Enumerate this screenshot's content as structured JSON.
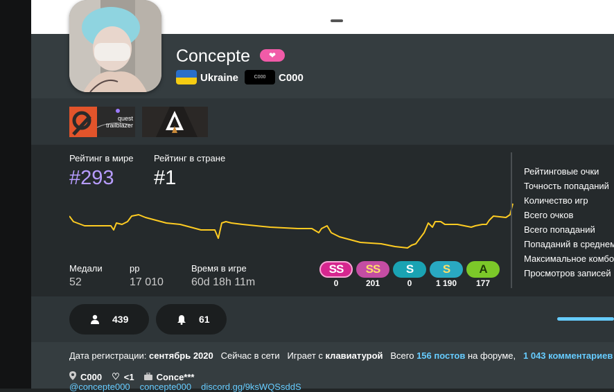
{
  "profile": {
    "username": "Concepte",
    "country": "Ukraine",
    "team_tag": "C000",
    "team_name": "C000"
  },
  "badges": {
    "badge1_text": "quest trailblazer"
  },
  "ranks": {
    "global_label": "Рейтинг в мире",
    "global_value": "#293",
    "country_label": "Рейтинг в стране",
    "country_value": "#1"
  },
  "summary": {
    "medals_label": "Медали",
    "medals_value": "52",
    "pp_label": "pp",
    "pp_value": "17 010",
    "playtime_label": "Время в игре",
    "playtime_value": "60d 18h 11m"
  },
  "grades": [
    {
      "label": "SS",
      "count": "0",
      "color": "#d6268f"
    },
    {
      "label": "SS",
      "count": "201",
      "color": "#c44da3"
    },
    {
      "label": "S",
      "count": "0",
      "color": "#1aa3b3"
    },
    {
      "label": "S",
      "count": "1 190",
      "color": "#29a9c2"
    },
    {
      "label": "A",
      "count": "177",
      "color": "#7cc829"
    }
  ],
  "stat_labels": [
    "Рейтинговые очки",
    "Точность попаданий",
    "Количество игр",
    "Всего очков",
    "Всего попаданий",
    "Попаданий в среднем",
    "Максимальное комбо",
    "Просмотров записей"
  ],
  "actions": {
    "friends_count": "439",
    "followers_count": "61"
  },
  "info": {
    "joined_prefix": "Дата регистрации:",
    "joined_value": "сентябрь 2020",
    "online_text": "Сейчас в сети",
    "plays_with_prefix": "Играет с",
    "plays_with_value": "клавиатурой",
    "forum_prefix": "Всего",
    "forum_posts": "156 постов",
    "forum_suffix": "на форуме,",
    "comments": "1 043 комментариев"
  },
  "meta": {
    "location": "C000",
    "interests": "<1",
    "occupation": "Conce***"
  },
  "links": {
    "twitter": "@concepte000",
    "discord_user": "concepte000",
    "discord_link": "discord.gg/9ksWQSsddS"
  },
  "colors": {
    "accent": "#66ccff",
    "rank_purple": "#b79cff",
    "graph_line": "#ffcc22",
    "heart_pink": "#f15ba8"
  }
}
